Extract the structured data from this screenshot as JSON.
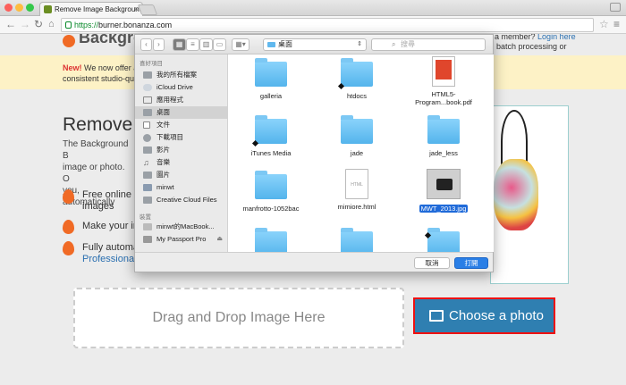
{
  "browser": {
    "tab_title": "Remove Image Backgrounds",
    "url_scheme": "https://",
    "url_host": "burner.bonanza.com"
  },
  "page": {
    "logo_text": "Backgro",
    "member_text": "a member?",
    "login_link": "Login here",
    "banner_new": "New!",
    "banner_text": "We now offer a Bac",
    "banner_text2": "consistent studio-quality",
    "banner_right": "batch processing or",
    "hero_title": "Remove I",
    "hero_lines": [
      "The Background B",
      "image or photo. O",
      "you, automatically"
    ],
    "features": [
      {
        "line1": "Free online to",
        "line2": "images"
      },
      {
        "line1": "Make your im",
        "line2": ""
      },
      {
        "line1": "Fully automat",
        "line2": "Professional"
      }
    ],
    "dropzone_text": "Drag and Drop Image Here",
    "choose_button": "Choose a photo"
  },
  "dialog": {
    "location": "桌面",
    "search_placeholder": "搜尋",
    "sidebar": {
      "favorites_header": "喜好項目",
      "favorites": [
        "我的所有檔案",
        "iCloud Drive",
        "應用程式",
        "桌面",
        "文件",
        "下載項目",
        "影片",
        "音樂",
        "圖片",
        "minwt",
        "Creative Cloud Files"
      ],
      "devices_header": "裝置",
      "devices": [
        "minwt的MacBook...",
        "My Passport Pro"
      ]
    },
    "files": [
      {
        "name": "galleria",
        "kind": "folder"
      },
      {
        "name": "htdocs",
        "kind": "folder"
      },
      {
        "name": "HTML5-Program...book.pdf",
        "kind": "pdf"
      },
      {
        "name": "iTunes Media",
        "kind": "folder"
      },
      {
        "name": "jade",
        "kind": "folder"
      },
      {
        "name": "jade_less",
        "kind": "folder"
      },
      {
        "name": "manfrotto-1052bac",
        "kind": "folder"
      },
      {
        "name": "mimiore.html",
        "kind": "html"
      },
      {
        "name": "MWT_2013.jpg",
        "kind": "image"
      }
    ],
    "cancel": "取消",
    "open": "打開"
  },
  "colors": {
    "accent_blue": "#2f7fb1",
    "highlight_red": "#e11111",
    "folder_blue": "#54b4ec",
    "brand_orange": "#f06a25"
  }
}
